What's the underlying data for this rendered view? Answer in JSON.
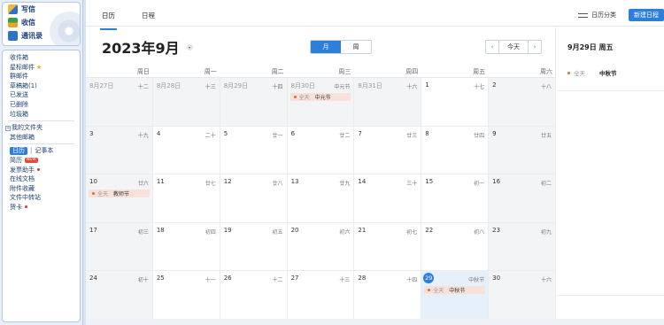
{
  "sidebar": {
    "actions": [
      {
        "label": "写信",
        "icon": "pencil-icon"
      },
      {
        "label": "收信",
        "icon": "inbox-icon"
      },
      {
        "label": "通讯录",
        "icon": "contacts-icon"
      }
    ],
    "folders": [
      {
        "label": "收件箱"
      },
      {
        "label": "星标邮件",
        "star": "★"
      },
      {
        "label": "群邮件"
      },
      {
        "label": "草稿箱(1)"
      },
      {
        "label": "已发送"
      },
      {
        "label": "已删除"
      },
      {
        "label": "垃圾箱"
      }
    ],
    "my_folders": {
      "expand": "+",
      "label": "我的文件夹"
    },
    "other_mail": "其他邮箱",
    "calendar_link": "日历",
    "divider": "|",
    "notes_link": "记事本",
    "apps": [
      {
        "label": "简历",
        "badge": "NEW"
      },
      {
        "label": "发票助手",
        "dot": true
      },
      {
        "label": "在线文档"
      },
      {
        "label": "附件收藏"
      },
      {
        "label": "文件中转站"
      },
      {
        "label": "贺卡",
        "dot": true
      }
    ]
  },
  "topbar": {
    "tabs": [
      "日历",
      "日程"
    ],
    "category_label": "日历分类",
    "new_button": "新建日程"
  },
  "calendar": {
    "month_title": "2023年9月",
    "view_month": "月",
    "view_week": "周",
    "prev": "‹",
    "today": "今天",
    "next": "›",
    "weekdays": [
      "周日",
      "周一",
      "周二",
      "周三",
      "周四",
      "周五",
      "周六"
    ],
    "weeks": [
      [
        {
          "day": "8月27日",
          "lunar": "十二",
          "other": true
        },
        {
          "day": "8月28日",
          "lunar": "十三",
          "other": true
        },
        {
          "day": "8月29日",
          "lunar": "十四",
          "other": true
        },
        {
          "day": "8月30日",
          "lunar": "中元节",
          "other": true,
          "event": {
            "allday": "全天",
            "name": "中元节"
          }
        },
        {
          "day": "8月31日",
          "lunar": "十六",
          "other": true
        },
        {
          "day": "1",
          "lunar": "十七"
        },
        {
          "day": "2",
          "lunar": "十八",
          "weekend": true
        }
      ],
      [
        {
          "day": "3",
          "lunar": "十九",
          "weekend": true
        },
        {
          "day": "4",
          "lunar": "二十"
        },
        {
          "day": "5",
          "lunar": "廿一"
        },
        {
          "day": "6",
          "lunar": "廿二"
        },
        {
          "day": "7",
          "lunar": "廿三"
        },
        {
          "day": "8",
          "lunar": "廿四"
        },
        {
          "day": "9",
          "lunar": "廿五",
          "weekend": true
        }
      ],
      [
        {
          "day": "10",
          "lunar": "廿六",
          "weekend": true,
          "event": {
            "allday": "全天",
            "name": "教师节"
          }
        },
        {
          "day": "11",
          "lunar": "廿七"
        },
        {
          "day": "12",
          "lunar": "廿八"
        },
        {
          "day": "13",
          "lunar": "廿九"
        },
        {
          "day": "14",
          "lunar": "三十"
        },
        {
          "day": "15",
          "lunar": "初一"
        },
        {
          "day": "16",
          "lunar": "初二",
          "weekend": true
        }
      ],
      [
        {
          "day": "17",
          "lunar": "初三",
          "weekend": true
        },
        {
          "day": "18",
          "lunar": "初四"
        },
        {
          "day": "19",
          "lunar": "初五"
        },
        {
          "day": "20",
          "lunar": "初六"
        },
        {
          "day": "21",
          "lunar": "初七"
        },
        {
          "day": "22",
          "lunar": "初八"
        },
        {
          "day": "23",
          "lunar": "初九",
          "weekend": true
        }
      ],
      [
        {
          "day": "24",
          "lunar": "初十",
          "weekend": true
        },
        {
          "day": "25",
          "lunar": "十一"
        },
        {
          "day": "26",
          "lunar": "十二"
        },
        {
          "day": "27",
          "lunar": "十三"
        },
        {
          "day": "28",
          "lunar": "十四"
        },
        {
          "day": "29",
          "lunar": "中秋节",
          "today": true,
          "event": {
            "allday": "全天",
            "name": "中秋节"
          }
        },
        {
          "day": "30",
          "lunar": "十六",
          "weekend": true
        }
      ]
    ]
  },
  "side_panel": {
    "date": "9月29日 周五",
    "event": {
      "allday": "全天",
      "name": "中秋节"
    }
  },
  "colors": {
    "accent": "#2e7fd9",
    "event_bg": "#f7e1d9",
    "event_dot": "#e06a3a"
  }
}
